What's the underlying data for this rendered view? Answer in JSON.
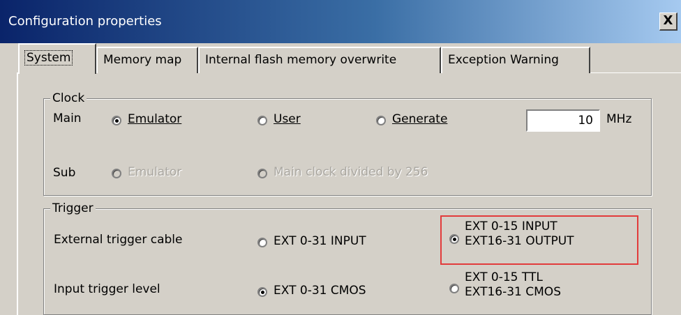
{
  "window": {
    "title": "Configuration properties",
    "close_label": "X"
  },
  "tabs": [
    {
      "label": "System",
      "active": true
    },
    {
      "label": "Memory map",
      "active": false
    },
    {
      "label": "Internal flash memory overwrite",
      "active": false
    },
    {
      "label": "Exception Warning",
      "active": false
    }
  ],
  "clock": {
    "legend": "Clock",
    "main_label": "Main",
    "sub_label": "Sub",
    "main_options": [
      {
        "label": "Emulator",
        "checked": true
      },
      {
        "label": "User",
        "checked": false
      },
      {
        "label": "Generate",
        "checked": false
      }
    ],
    "frequency_value": "10",
    "frequency_unit": "MHz",
    "sub_options": [
      {
        "label": "Emulator",
        "disabled": true
      },
      {
        "label": "Main clock divided by 256",
        "disabled": true
      }
    ]
  },
  "trigger": {
    "legend": "Trigger",
    "cable_label": "External trigger cable",
    "level_label": "Input trigger level",
    "cable_option1": "EXT 0-31  INPUT",
    "cable_option2_line1": "EXT 0-15  INPUT",
    "cable_option2_line2": "EXT16-31  OUTPUT",
    "level_option1": "EXT 0-31  CMOS",
    "level_option2_line1": "EXT 0-15  TTL",
    "level_option2_line2": "EXT16-31  CMOS"
  },
  "colors": {
    "highlight_box": "#e23b3b",
    "dialog_face": "#d4d0c8",
    "titlebar": "#0a246a"
  }
}
